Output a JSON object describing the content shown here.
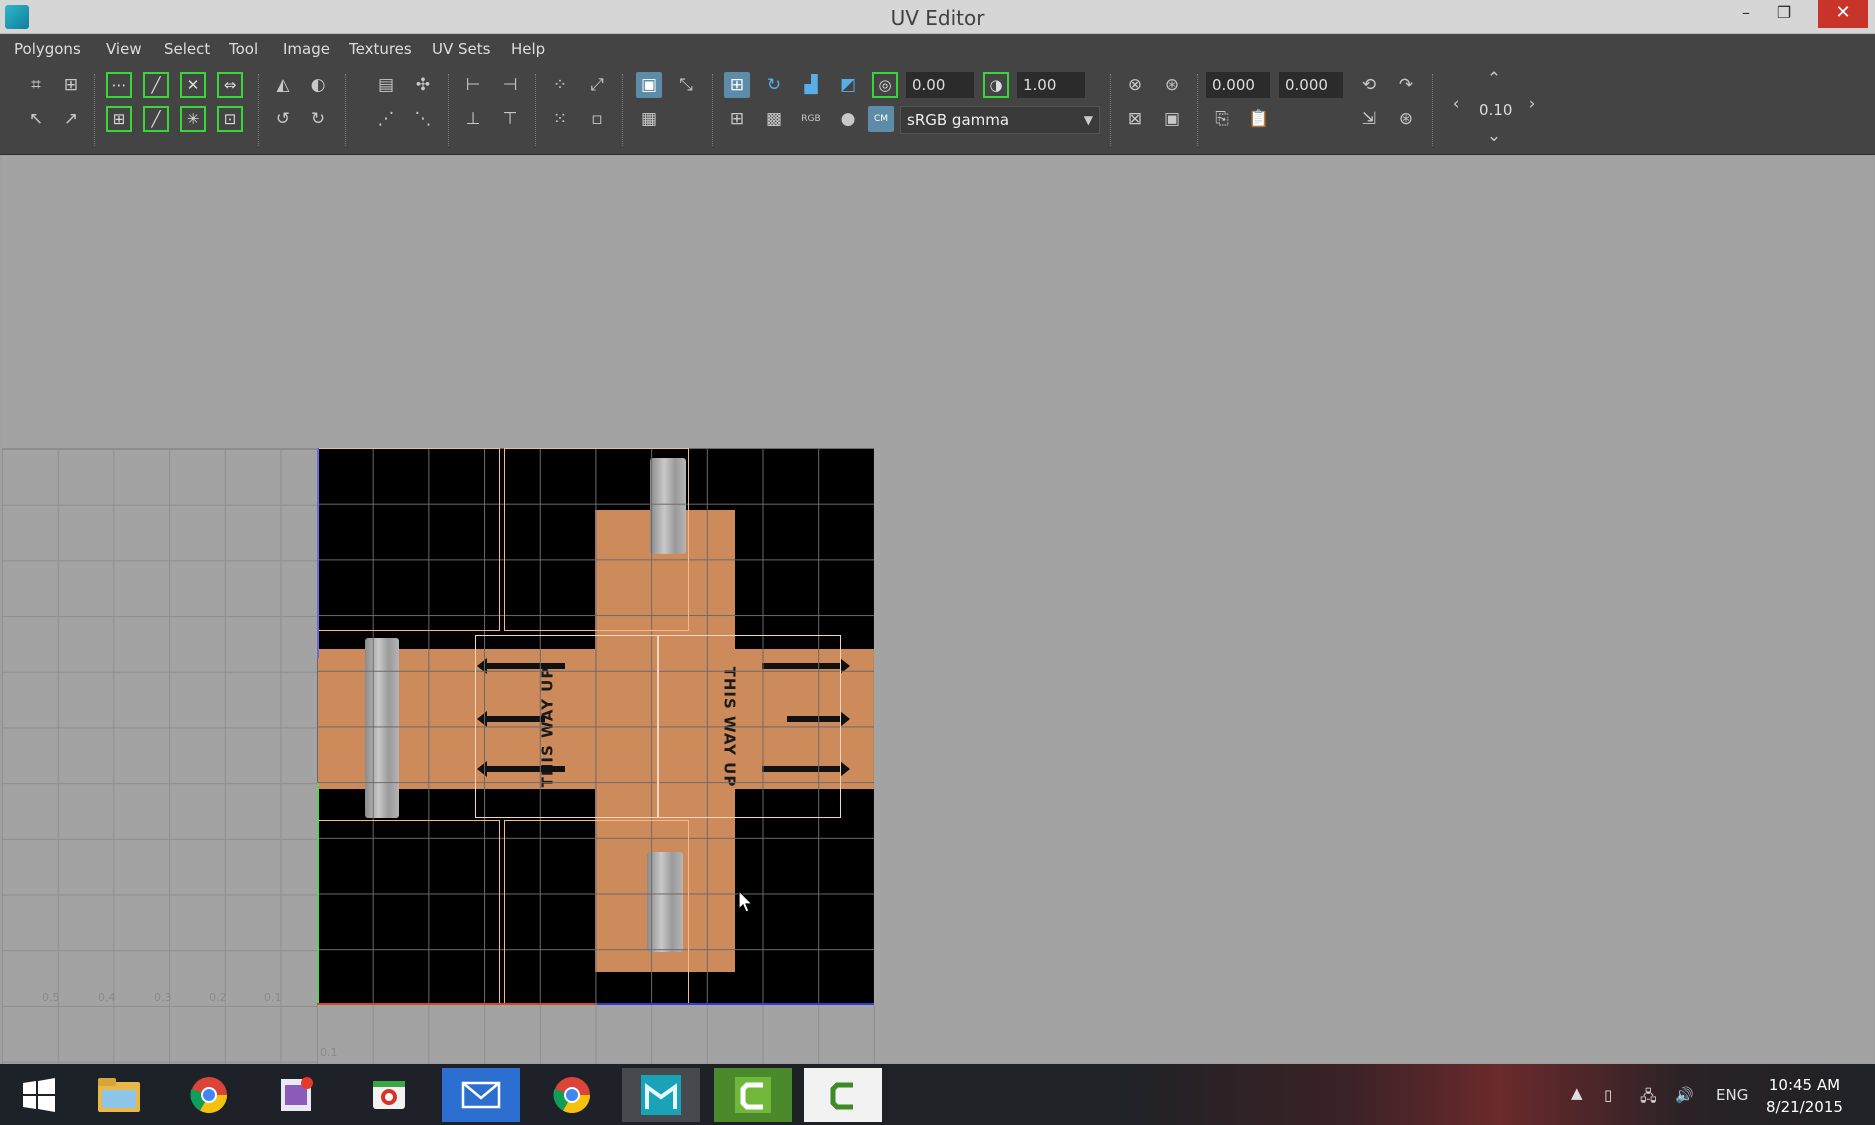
{
  "window": {
    "title": "UV Editor",
    "minimize": "–",
    "maximize": "❐",
    "close": "✕"
  },
  "menu": [
    "Polygons",
    "View",
    "Select",
    "Tool",
    "Image",
    "Textures",
    "UV Sets",
    "Help"
  ],
  "toolbar": {
    "exposure_value": "0.00",
    "gamma_value": "1.00",
    "color_space": "sRGB gamma",
    "u_value": "0.000",
    "v_value": "0.000",
    "step_value": "0.10"
  },
  "texture": {
    "label_left": "THIS WAY UP",
    "label_right": "THIS WAY UP",
    "colors": {
      "cardboard": "#cd8b5c",
      "uv_shell": "#f5b98a",
      "background": "#000000"
    }
  },
  "axis": {
    "labels": [
      "0.5",
      "0.4",
      "0.3",
      "0.2",
      "0.1"
    ],
    "v_label": "0.1"
  },
  "taskbar": {
    "apps": [
      "windows-start",
      "file-explorer",
      "chrome",
      "app-4",
      "app-5",
      "mail",
      "chrome-2",
      "maya",
      "camtasia-recorder",
      "camtasia-studio"
    ],
    "language": "ENG",
    "time": "10:45 AM",
    "date": "8/21/2015"
  }
}
